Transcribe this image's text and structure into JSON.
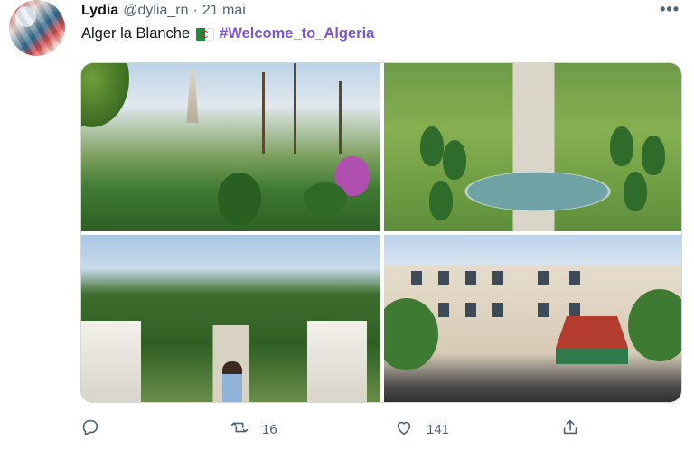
{
  "tweet": {
    "display_name": "Lydia",
    "handle": "@dylia_rn",
    "separator": "·",
    "date": "21 mai",
    "text": "Alger la Blanche",
    "flag_icon": "algeria-flag-icon",
    "hashtag": "#Welcome_to_Algeria",
    "more_icon": "more-icon",
    "more_label": "•••"
  },
  "photos": [
    {
      "name": "photo-martyrs-memorial-garden"
    },
    {
      "name": "photo-jardin-essai-fountain"
    },
    {
      "name": "photo-garden-alley-person"
    },
    {
      "name": "photo-algiers-building-street"
    }
  ],
  "actions": {
    "reply": {
      "icon": "reply-icon",
      "count": ""
    },
    "retweet": {
      "icon": "retweet-icon",
      "count": "16"
    },
    "like": {
      "icon": "heart-icon",
      "count": "141"
    },
    "share": {
      "icon": "share-icon",
      "count": ""
    }
  },
  "colors": {
    "hashtag": "#7b55d6",
    "muted": "#536471"
  }
}
